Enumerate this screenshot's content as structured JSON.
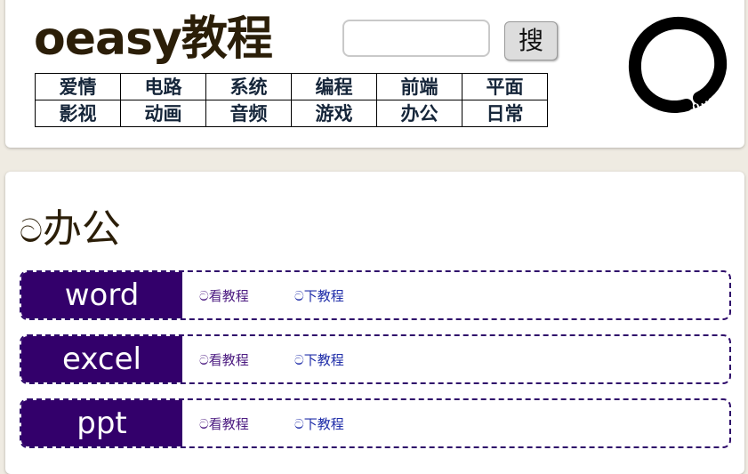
{
  "header": {
    "logo_text": "oeasy教程",
    "search": {
      "value": "",
      "placeholder": ""
    },
    "search_button_label": "搜",
    "nav_rows": [
      [
        "爱情",
        "电路",
        "系统",
        "编程",
        "前端",
        "平面"
      ],
      [
        "影视",
        "动画",
        "音频",
        "游戏",
        "办公",
        "日常"
      ]
    ]
  },
  "main": {
    "title_prefix": "ට",
    "title": "办公",
    "courses": [
      {
        "name": "word",
        "view_label": "ට看教程",
        "download_label": "ට下教程"
      },
      {
        "name": "excel",
        "view_label": "ට看教程",
        "download_label": "ට下教程"
      },
      {
        "name": "ppt",
        "view_label": "ට看教程",
        "download_label": "ට下教程"
      }
    ]
  },
  "colors": {
    "background": "#efebe2",
    "card": "#ffffff",
    "logo": "#2b1e08",
    "course_label_bg": "#33006b",
    "row_border": "#2e0a6a",
    "link_view": "#4b1a80",
    "link_download": "#1e2ca8"
  },
  "icons": {
    "brand_mark": "enso-circle-icon"
  }
}
